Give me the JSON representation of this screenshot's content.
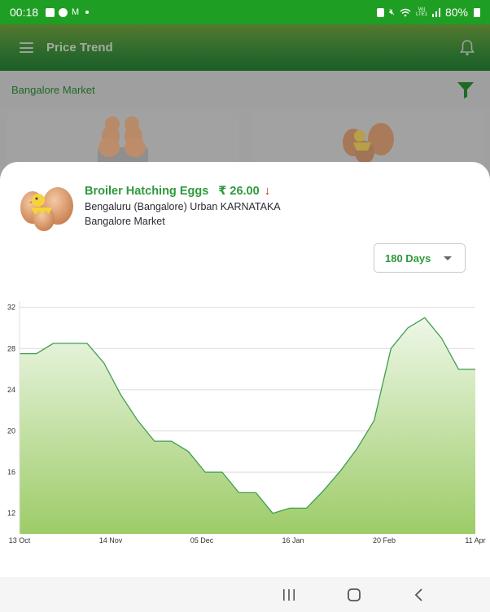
{
  "status_bar": {
    "time": "00:18",
    "left_icons": [
      "gallery-icon",
      "facebook-icon",
      "gmail-icon",
      "notification-dot-icon"
    ],
    "right_icons": [
      "battery-saver-icon",
      "mute-icon",
      "wifi-icon",
      "volte-lte-icon",
      "signal-icon"
    ],
    "battery": "80%"
  },
  "app_bar": {
    "title": "Price Trend",
    "menu_icon": "hamburger-menu-icon",
    "notification_icon": "bell-icon"
  },
  "market_bar": {
    "label": "Bangalore Market",
    "filter_icon": "filter-icon"
  },
  "background_cards": [
    {
      "image": "egg-tray-image"
    },
    {
      "image": "hatching-chick-eggs-image"
    }
  ],
  "product": {
    "name": "Broiler Hatching Eggs",
    "price": "₹ 26.00",
    "trend": "down",
    "trend_glyph": "↓",
    "location": "Bengaluru (Bangalore) Urban KARNATAKA",
    "market": "Bangalore Market",
    "colors": {
      "accent": "#2e9a3c",
      "down": "#d42018"
    }
  },
  "range_select": {
    "selected": "180 Days"
  },
  "chart_data": {
    "type": "area",
    "title": "",
    "xlabel": "",
    "ylabel": "",
    "ylim": [
      10,
      33
    ],
    "yticks": [
      12,
      16,
      20,
      24,
      28,
      32
    ],
    "grid": true,
    "x_tick_labels": [
      "13 Oct",
      "14 Nov",
      "05 Dec",
      "16 Jan",
      "20 Feb",
      "11 Apr"
    ],
    "series": [
      {
        "name": "Broiler Hatching Eggs",
        "color": "#3f9e50",
        "fill_top": "#eef7e8",
        "fill_bottom": "#9dcc68",
        "values": [
          27.5,
          27.5,
          28.5,
          28.5,
          28.5,
          26.6,
          23.5,
          21.0,
          19.0,
          19.0,
          18.0,
          16.0,
          16.0,
          14.0,
          14.0,
          12.0,
          12.5,
          12.5,
          14.2,
          16.1,
          18.3,
          21.0,
          28.0,
          30.0,
          31.0,
          29.0,
          26.0,
          26.0
        ]
      }
    ]
  },
  "nav_bar": {
    "buttons": [
      "recent-apps",
      "home",
      "back"
    ]
  }
}
